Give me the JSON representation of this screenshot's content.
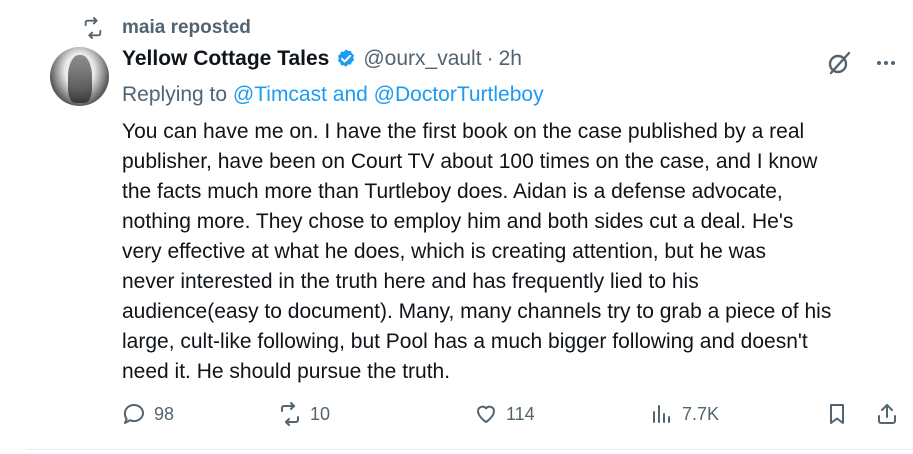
{
  "repost": {
    "label": "maia reposted",
    "icon": "repost-icon"
  },
  "tweet": {
    "author_name": "Yellow Cottage Tales",
    "handle": "@ourx_vault",
    "separator": "·",
    "time": "2h",
    "verified_color": "#1d9bf0",
    "replying_prefix": "Replying to",
    "replying_to": "@Timcast and @DoctorTurtleboy",
    "text_lines": [
      "You can have me on. I have the first book on the case published by a real",
      "publisher, have been on Court TV about 100 times on the case, and I know",
      "the facts much more than Turtleboy does. Aidan is a defense advocate,",
      "nothing more. They chose to employ him and both sides cut a deal. He's",
      "very effective at what he does, which is creating attention, but he was",
      "never interested in the truth here and has frequently lied to his",
      "audience(easy to document). Many, many channels try to grab a piece of his",
      "large, cult-like following, but Pool has a much bigger following and doesn't",
      "need it. He should pursue the truth."
    ]
  },
  "actions": {
    "replies": "98",
    "reposts": "10",
    "likes": "114",
    "views": "7.7K"
  },
  "colors": {
    "text": "#0f1419",
    "secondary": "#536471",
    "link": "#1d9bf0"
  }
}
